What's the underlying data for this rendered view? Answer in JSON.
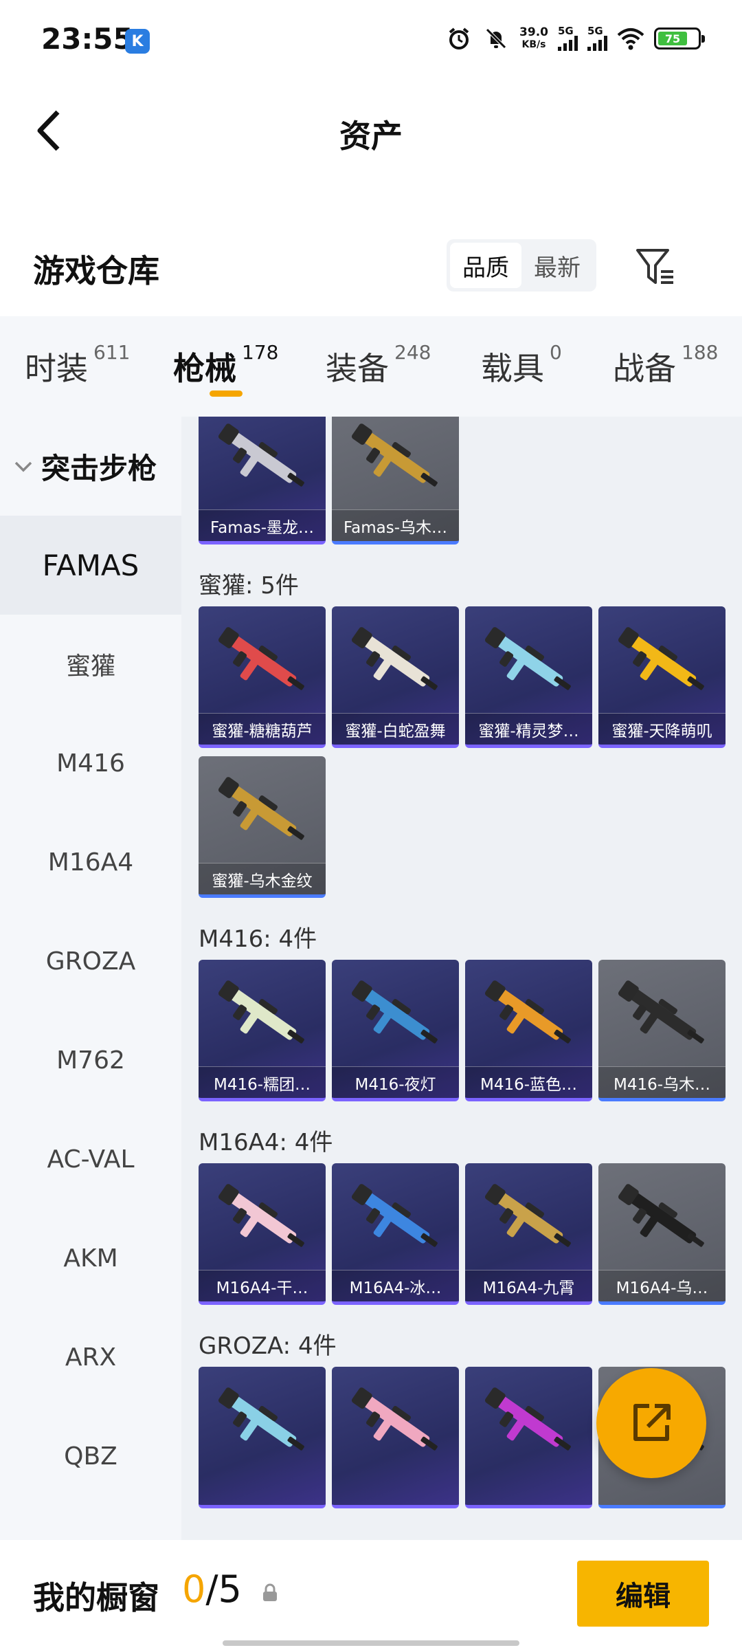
{
  "status_bar": {
    "time": "23:55",
    "app_badge": "K",
    "net_speed_value": "39.0",
    "net_speed_unit": "KB/s",
    "signal1": "5G",
    "signal2": "5G",
    "battery": "75",
    "icons": [
      "alarm-icon",
      "mute-bell-icon",
      "signal-icon",
      "wifi-icon",
      "battery-icon"
    ]
  },
  "header": {
    "title": "资产"
  },
  "warehouse": {
    "title": "游戏仓库",
    "sort_options": [
      "品质",
      "最新"
    ],
    "active_sort": "品质"
  },
  "tabs": [
    {
      "label": "时装",
      "count": "611"
    },
    {
      "label": "枪械",
      "count": "178",
      "active": true
    },
    {
      "label": "装备",
      "count": "248"
    },
    {
      "label": "载具",
      "count": "0"
    },
    {
      "label": "战备",
      "count": "188"
    }
  ],
  "sidebar": {
    "category": "突击步枪",
    "items": [
      "FAMAS",
      "蜜獾",
      "M416",
      "M16A4",
      "GROZA",
      "M762",
      "AC-VAL",
      "AKM",
      "ARX",
      "QBZ"
    ],
    "active": "FAMAS"
  },
  "sections": [
    {
      "title": "",
      "items": [
        {
          "name": "Famas-墨龙…",
          "tone": "purple",
          "color": "#c9c9d2"
        },
        {
          "name": "Famas-乌木…",
          "tone": "gray",
          "color": "#c89a35"
        }
      ]
    },
    {
      "title": "蜜獾: 5件",
      "items": [
        {
          "name": "蜜獾-糖糖葫芦",
          "tone": "purple",
          "color": "#e04b4b"
        },
        {
          "name": "蜜獾-白蛇盈舞",
          "tone": "purple",
          "color": "#e8e2d6"
        },
        {
          "name": "蜜獾-精灵梦…",
          "tone": "purple",
          "color": "#8fd3e8"
        },
        {
          "name": "蜜獾-天降萌叽",
          "tone": "purple",
          "color": "#f2b817"
        },
        {
          "name": "蜜獾-乌木金纹",
          "tone": "gray",
          "color": "#c89a35"
        }
      ]
    },
    {
      "title": "M416: 4件",
      "items": [
        {
          "name": "M416-糯团…",
          "tone": "purple",
          "color": "#dfe8c9"
        },
        {
          "name": "M416-夜灯",
          "tone": "purple",
          "color": "#3c8ed0"
        },
        {
          "name": "M416-蓝色…",
          "tone": "purple",
          "color": "#e89a28"
        },
        {
          "name": "M416-乌木…",
          "tone": "gray",
          "color": "#2c2c2c"
        }
      ]
    },
    {
      "title": "M16A4: 4件",
      "items": [
        {
          "name": "M16A4-干…",
          "tone": "purple",
          "color": "#f2c7d4"
        },
        {
          "name": "M16A4-冰…",
          "tone": "purple",
          "color": "#3d86e0"
        },
        {
          "name": "M16A4-九霄",
          "tone": "purple",
          "color": "#c9a24a"
        },
        {
          "name": "M16A4-乌…",
          "tone": "gray",
          "color": "#1f1f1f"
        }
      ]
    },
    {
      "title": "GROZA: 4件",
      "items": [
        {
          "name": "",
          "tone": "purple",
          "color": "#8ad0e6"
        },
        {
          "name": "",
          "tone": "purple",
          "color": "#f0a8c0"
        },
        {
          "name": "",
          "tone": "purple",
          "color": "#c03ad0"
        },
        {
          "name": "",
          "tone": "gray",
          "color": "#d8a830"
        }
      ]
    }
  ],
  "showcase": {
    "title": "我的橱窗",
    "current": "0",
    "total": "/5",
    "edit_label": "编辑"
  }
}
